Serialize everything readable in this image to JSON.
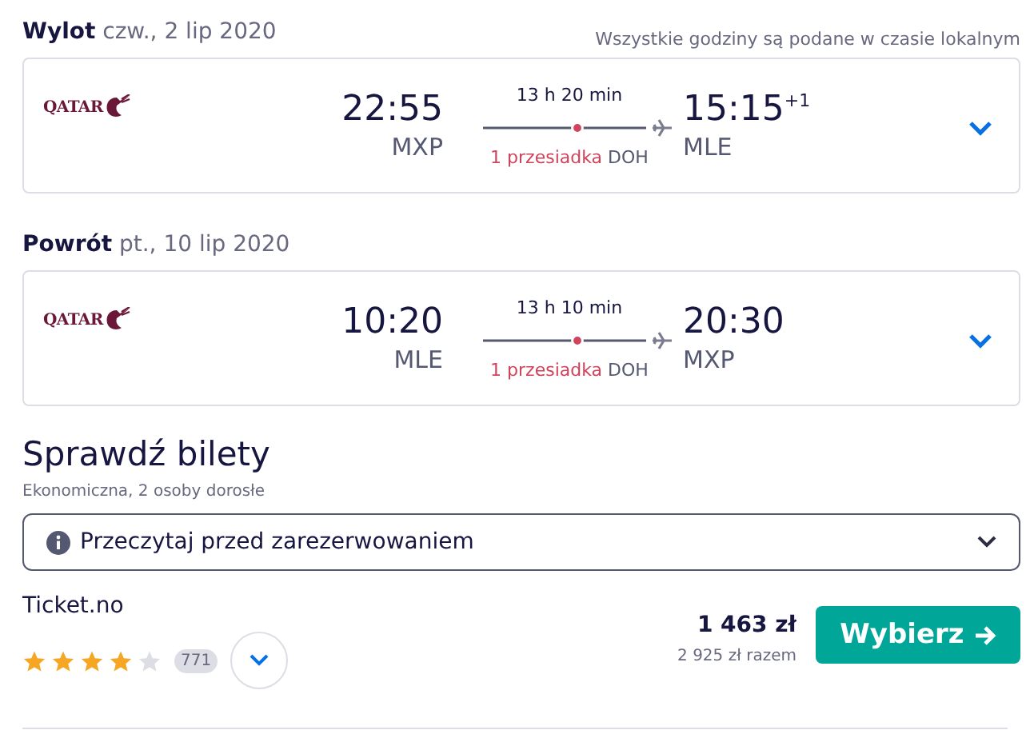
{
  "legs": [
    {
      "label": "Wylot",
      "date": "czw., 2 lip 2020",
      "note": "Wszystkie godziny są podane w czasie lokalnym",
      "airline_logo": "QATAR",
      "depart_time": "22:55",
      "depart_airport": "MXP",
      "duration": "13 h 20 min",
      "stops": "1 przesiadka",
      "stop_airport": "DOH",
      "arrive_time": "15:15",
      "arrive_offset": "+1",
      "arrive_airport": "MLE"
    },
    {
      "label": "Powrót",
      "date": "pt., 10 lip 2020",
      "airline_logo": "QATAR",
      "depart_time": "10:20",
      "depart_airport": "MLE",
      "duration": "13 h 10 min",
      "stops": "1 przesiadka",
      "stop_airport": "DOH",
      "arrive_time": "20:30",
      "arrive_airport": "MXP"
    }
  ],
  "tickets": {
    "title": "Sprawdź bilety",
    "subtitle": "Ekonomiczna, 2 osoby dorosłe",
    "notice": "Przeczytaj przed zarezerwowaniem",
    "offer": {
      "agent": "Ticket.no",
      "stars": 4,
      "reviews": "771",
      "price": "1 463 zł",
      "total": "2 925 zł razem",
      "button": "Wybierz"
    }
  }
}
